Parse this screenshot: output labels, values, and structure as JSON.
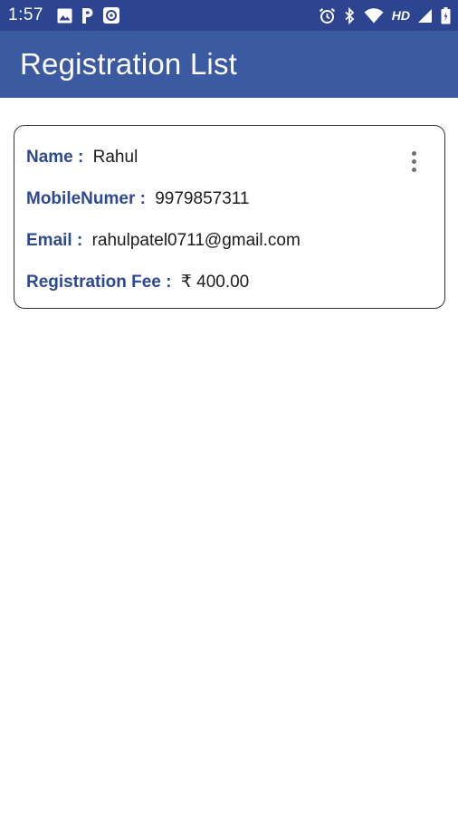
{
  "status_bar": {
    "time": "1:57",
    "network_label": "HD",
    "left_icons": [
      "image-icon",
      "parking-icon",
      "app-notification-icon"
    ],
    "right_icons": [
      "alarm-icon",
      "bluetooth-icon",
      "wifi-icon",
      "hd-icon",
      "battery-icon"
    ]
  },
  "app_bar": {
    "title": "Registration List",
    "color": "#3b5aa1"
  },
  "registration_list": [
    {
      "name_label": "Name :",
      "name": "Rahul",
      "mobile_label": "MobileNumer :",
      "mobile": "9979857311",
      "email_label": "Email :",
      "email": "rahulpatel0711@gmail.com",
      "fee_label": "Registration Fee :",
      "fee": "₹ 400.00",
      "menu_icon": "more-vert-icon"
    }
  ],
  "colors": {
    "status_bar": "#2d4590",
    "label": "#2d4a8f",
    "value": "#1c1c1c"
  }
}
